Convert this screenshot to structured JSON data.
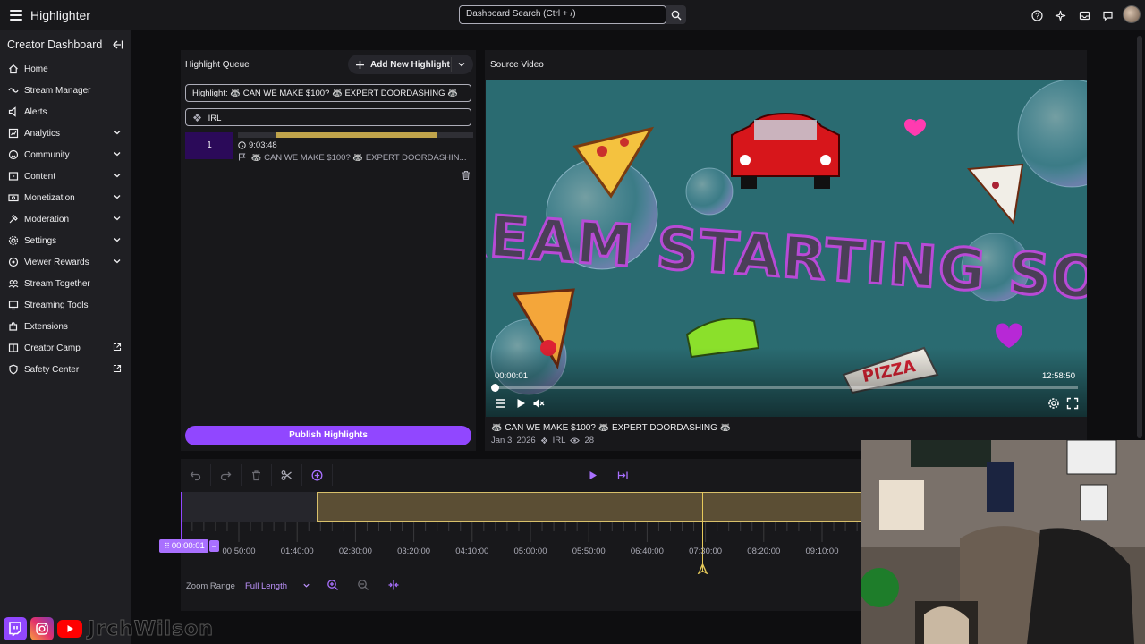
{
  "topbar": {
    "app_title": "Highlighter",
    "search_placeholder": "Dashboard Search (Ctrl + /)"
  },
  "sidebar": {
    "title": "Creator Dashboard",
    "items": [
      {
        "label": "Home",
        "icon": "home-icon",
        "expandable": false,
        "external": false
      },
      {
        "label": "Stream Manager",
        "icon": "stream-manager-icon",
        "expandable": false,
        "external": false
      },
      {
        "label": "Alerts",
        "icon": "alerts-icon",
        "expandable": false,
        "external": false
      },
      {
        "label": "Analytics",
        "icon": "analytics-icon",
        "expandable": true,
        "external": false
      },
      {
        "label": "Community",
        "icon": "community-icon",
        "expandable": true,
        "external": false
      },
      {
        "label": "Content",
        "icon": "content-icon",
        "expandable": true,
        "external": false
      },
      {
        "label": "Monetization",
        "icon": "monetization-icon",
        "expandable": true,
        "external": false
      },
      {
        "label": "Moderation",
        "icon": "moderation-icon",
        "expandable": true,
        "external": false
      },
      {
        "label": "Settings",
        "icon": "settings-icon",
        "expandable": true,
        "external": false
      },
      {
        "label": "Viewer Rewards",
        "icon": "viewer-rewards-icon",
        "expandable": true,
        "external": false
      },
      {
        "label": "Stream Together",
        "icon": "stream-together-icon",
        "expandable": false,
        "external": false
      },
      {
        "label": "Streaming Tools",
        "icon": "streaming-tools-icon",
        "expandable": false,
        "external": false
      },
      {
        "label": "Extensions",
        "icon": "extensions-icon",
        "expandable": false,
        "external": false
      },
      {
        "label": "Creator Camp",
        "icon": "creator-camp-icon",
        "expandable": false,
        "external": true
      },
      {
        "label": "Safety Center",
        "icon": "safety-center-icon",
        "expandable": false,
        "external": true
      }
    ]
  },
  "queue": {
    "title": "Highlight Queue",
    "add_button": "Add New Highlight",
    "highlight_title_value": "Highlight: 🦝 CAN WE MAKE $100? 🦝 EXPERT DOORDASHING 🦝",
    "category_value": "IRL",
    "clips": [
      {
        "number": "1",
        "duration": "9:03:48",
        "title": "🦝 CAN WE MAKE $100? 🦝 EXPERT DOORDASHIN..."
      }
    ],
    "publish_button": "Publish Highlights"
  },
  "source": {
    "title": "Source Video",
    "current_time": "00:00:01",
    "total_time": "12:58:50",
    "overlay_text": "STREAM STARTING SOON",
    "progress_fraction": 0.0,
    "video_title": "🦝 CAN WE MAKE $100? 🦝 EXPERT DOORDASHING 🦝",
    "date": "Jan 3, 2026",
    "category": "IRL",
    "views": "28"
  },
  "timeline": {
    "playhead_time": "00:00:01",
    "tick_labels": [
      "00:50:00",
      "01:40:00",
      "02:30:00",
      "03:20:00",
      "04:10:00",
      "05:00:00",
      "05:50:00",
      "06:40:00",
      "07:30:00",
      "08:20:00",
      "09:10:00"
    ],
    "zoom_label": "Zoom Range",
    "zoom_value": "Full Length"
  },
  "overlay": {
    "brand_name": "JrchWilson"
  },
  "colors": {
    "accent": "#9147ff",
    "selection_fill": "#5b4e34",
    "selection_border": "#d8c06b"
  }
}
